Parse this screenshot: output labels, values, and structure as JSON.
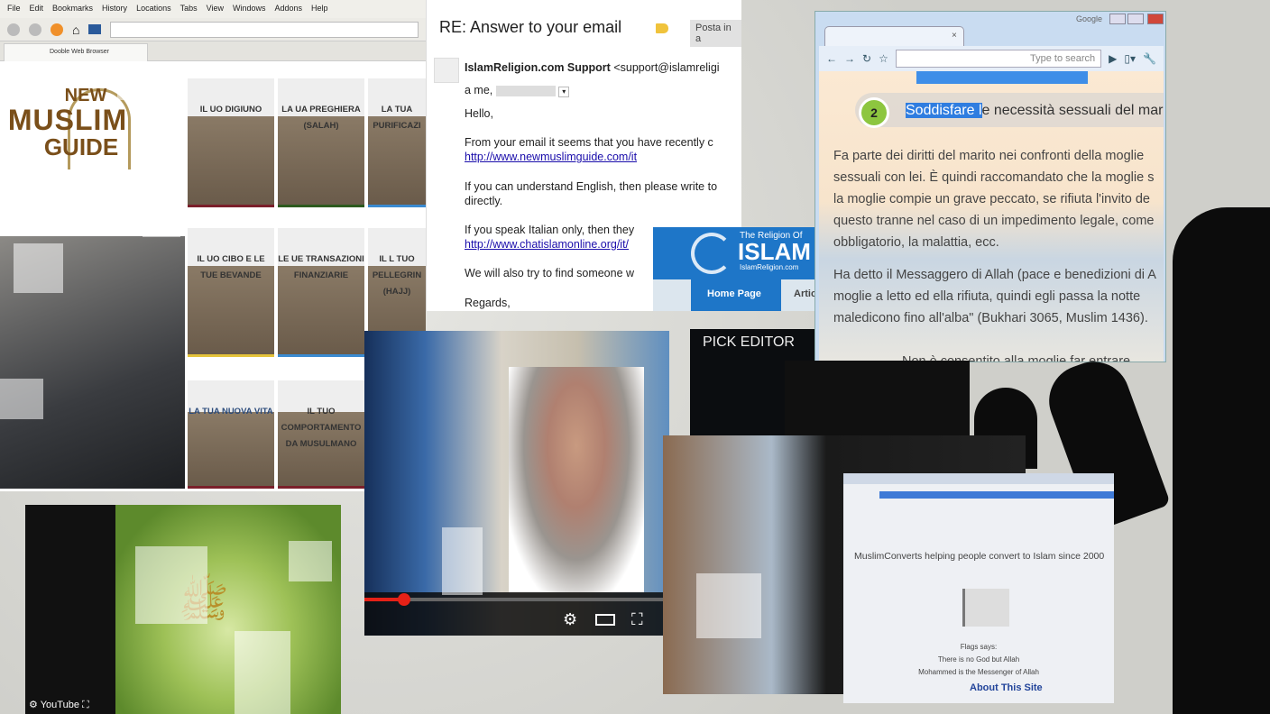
{
  "dooble": {
    "menu": [
      "File",
      "Edit",
      "Bookmarks",
      "History",
      "Locations",
      "Tabs",
      "View",
      "Windows",
      "Addons",
      "Help"
    ],
    "tab_title": "Dooble Web Browser",
    "logo": [
      "NEW",
      "MUSLIM",
      "GUIDE"
    ],
    "tiles": [
      "IL UO DIGIUNO",
      "LA UA PREGHIERA (SALAH)",
      "LA TUA PURIFICAZI",
      "IL UO CIBO E LE TUE BEVANDE",
      "LE UE TRANSAZIONI FINANZIARIE",
      "IL L TUO PELLEGRIN (HAJJ)",
      "LA TUA NUOVA VITA",
      "IL TUO COMPORTAMENTO DA MUSULMANO"
    ]
  },
  "email": {
    "subject": "RE: Answer to your email",
    "label": "Posta in a",
    "sender": "IslamReligion.com Support",
    "sender_addr": "<support@islamreligi",
    "to": "a me,",
    "lines": [
      "Hello,",
      "From your email it seems that you have recently c",
      "If you can understand English, then please write to",
      "directly.",
      "If you speak Italian only, then they",
      "We will also try to find someone w",
      "Regards,"
    ],
    "links": [
      "http://www.newmuslimguide.com/it",
      "http://www.chatislamonline.org/it/"
    ]
  },
  "islam_site": {
    "t1": "The Religion Of",
    "t2": "ISLAM",
    "t3": "IslamReligion.com",
    "nav_home": "Home Page",
    "nav_art": "Artic",
    "pick": "PICK EDITOR"
  },
  "chrome": {
    "brand": "Google",
    "search_placeholder": "Type to search",
    "step": "2",
    "heading_sel": "Soddisfare l",
    "heading_rest": "e necessità sessuali del marit",
    "paragraphs": [
      "Fa parte dei diritti del marito nei confronti della moglie",
      "sessuali con lei. È quindi raccomandato che la moglie s",
      "la moglie compie un grave peccato, se rifiuta l'invito de",
      "questo tranne nel caso di un impedimento legale, come",
      "obbligatorio, la malattia, ecc.",
      "Ha detto il Messaggero di Allah (pace e benedizioni di A",
      "moglie a letto ed ella rifiuta, quindi egli passa la notte",
      "maledicono fino all'alba\" (Bukhari 3065, Muslim 1436).",
      "Non è consentito alla moglie far entrare"
    ]
  },
  "video": {
    "progress_fraction": 0.13,
    "accent": "#e62117"
  },
  "youtube_label": "YouTube",
  "laptop_screen": {
    "tagline": "MuslimConverts helping people convert to Islam since 2000",
    "flag_caption": "Flags says:",
    "line1": "There is no God but Allah",
    "line2": "Mohammed is the Messenger of Allah",
    "about": "About This Site"
  }
}
